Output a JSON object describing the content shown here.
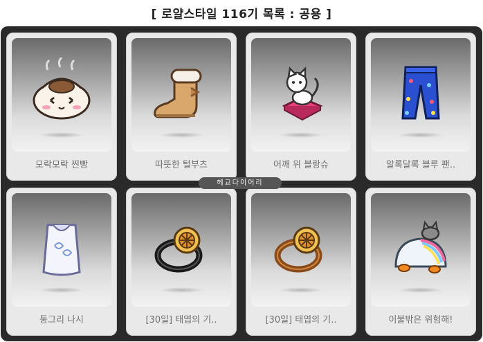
{
  "title": "[ 로얄스타일 116기 목록 : 공용 ]",
  "watermark": "헤교다이어리",
  "items": [
    {
      "label": "모락모락 찐빵",
      "icon": "steamed-bun-hat-icon"
    },
    {
      "label": "따뜻한 털부츠",
      "icon": "fur-boots-icon"
    },
    {
      "label": "어깨 위 블랑슈",
      "icon": "cat-on-cushion-icon"
    },
    {
      "label": "알록달록 블루 팬..",
      "icon": "blue-pants-icon"
    },
    {
      "label": "둥그리 나시",
      "icon": "sleeveless-top-icon"
    },
    {
      "label": "[30일] 태엽의 기..",
      "icon": "clockwork-ring-icon"
    },
    {
      "label": "[30일] 태엽의 기..",
      "icon": "clockwork-ring-gold-icon"
    },
    {
      "label": "이불밖은 위험해!",
      "icon": "blanket-cat-icon"
    }
  ]
}
